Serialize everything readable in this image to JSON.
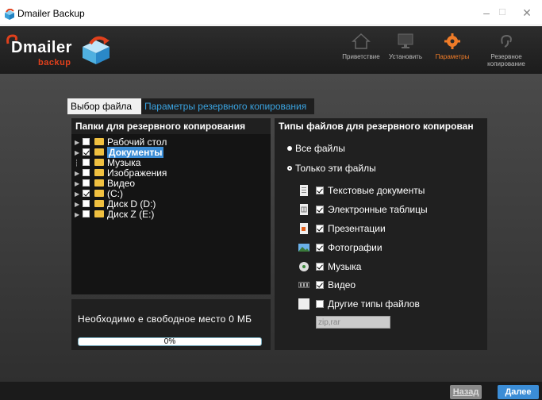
{
  "window": {
    "title": "Dmailer Backup",
    "controls": {
      "minimize": "–",
      "maximize": "☐",
      "close": "✕"
    }
  },
  "logo": {
    "line1": "Dmailer",
    "line2": "backup"
  },
  "nav": [
    {
      "label": "Приветствие",
      "icon": "home-icon"
    },
    {
      "label": "Установить",
      "icon": "monitor-icon"
    },
    {
      "label": "Параметры",
      "icon": "gear-icon",
      "active": true
    },
    {
      "label_line1": "Резервное",
      "label_line2": "копирование",
      "icon": "backup-icon"
    }
  ],
  "tabs": {
    "active": "Выбор файла",
    "inactive": "Параметры резервного копирования"
  },
  "folders_panel": {
    "header": "Папки для резервного копирования",
    "items": [
      {
        "label": "Рабочий стол",
        "checked": false,
        "expandable": true
      },
      {
        "label": "Документы",
        "checked": true,
        "expandable": true,
        "selected": true
      },
      {
        "label": "Музыка",
        "checked": false,
        "expandable": false
      },
      {
        "label": "Изображения",
        "checked": false,
        "expandable": true
      },
      {
        "label": "Видео",
        "checked": false,
        "expandable": true
      },
      {
        "label": "(C:)",
        "checked": true,
        "expandable": true
      },
      {
        "label": "Диск D (D:)",
        "checked": false,
        "expandable": true
      },
      {
        "label": "Диск Z (E:)",
        "checked": false,
        "expandable": true
      }
    ]
  },
  "space_panel": {
    "text": "Необходимо е свободное место 0 МБ",
    "progress_label": "0%",
    "progress": 0
  },
  "types_panel": {
    "header": "Типы файлов для резервного копирован",
    "radio_all": "Все файлы",
    "radio_only": "Только эти файлы",
    "types": [
      {
        "label": "Текстовые документы",
        "checked": true,
        "icon": "document-icon"
      },
      {
        "label": "Электронные таблицы",
        "checked": true,
        "icon": "spreadsheet-icon"
      },
      {
        "label": "Презентации",
        "checked": true,
        "icon": "presentation-icon"
      },
      {
        "label": "Фотографии",
        "checked": true,
        "icon": "photo-icon"
      },
      {
        "label": "Музыка",
        "checked": true,
        "icon": "music-icon"
      },
      {
        "label": "Видео",
        "checked": true,
        "icon": "video-icon"
      },
      {
        "label": "Другие типы файлов",
        "checked": false,
        "icon": "blank-file-icon"
      }
    ],
    "ext_value": "zip,rar"
  },
  "footer": {
    "back": "Назад",
    "next": "Далее"
  },
  "colors": {
    "accent_blue": "#3b8dd6",
    "accent_orange": "#f07c28",
    "logo_red": "#e0401c"
  }
}
